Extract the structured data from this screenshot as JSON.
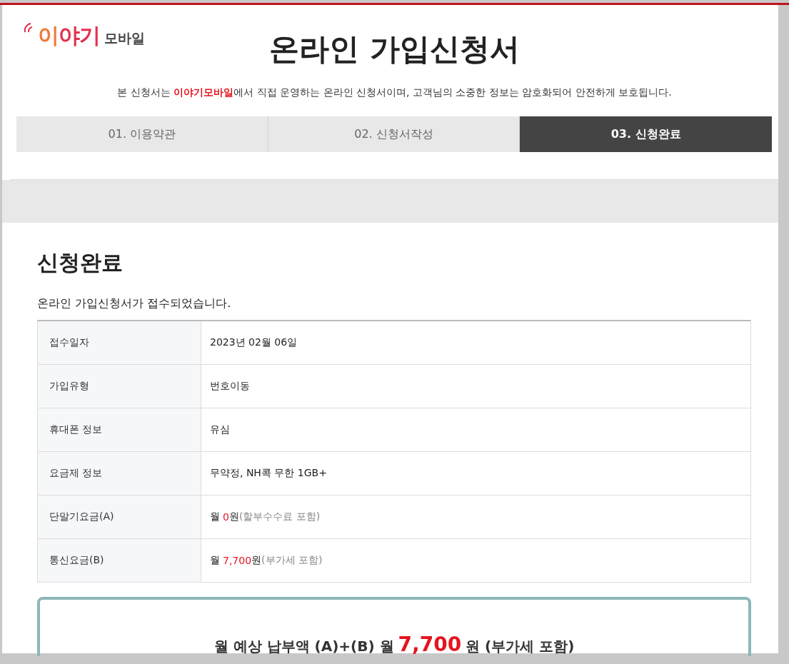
{
  "logo": {
    "brand": "이야기",
    "suffix": "모바일"
  },
  "title": "온라인 가입신청서",
  "intro": "본 신청서는 **이야기모바일**에서 직접 운영하는 온라인 신청서이며, 고객님의 소중한 정보는 암호화되어 안전하게 보호됩니다.",
  "steps": [
    {
      "label": "01. 이용약관",
      "selected": false
    },
    {
      "label": "02. 신청서작성",
      "selected": false
    },
    {
      "label": "03. 신청완료",
      "selected": true
    }
  ],
  "result": {
    "heading": "신청완료",
    "message": "온라인 가입신청서가 접수되었습니다.",
    "rows": [
      {
        "kind": "text",
        "label": "접수일자",
        "value": "2023년 02월 06일"
      },
      {
        "kind": "text",
        "label": "가입유형",
        "value": "번호이동"
      },
      {
        "kind": "text",
        "label": "휴대폰 정보",
        "value": "유심"
      },
      {
        "kind": "text",
        "label": "요금제 정보",
        "value": "무약정, NH콕 무한 1GB+"
      },
      {
        "kind": "fee",
        "label": "단말기요금(A)",
        "prefix": "월",
        "amount": "0",
        "unit": "원",
        "note": "(할부수수료 포함)"
      },
      {
        "kind": "fee",
        "label": "통신요금(B)",
        "prefix": "월",
        "amount": "7,700",
        "unit": "원",
        "note": "(부가세 포함)"
      }
    ],
    "total": {
      "label": "월 예상 납부액 (A)+(B) 월",
      "amount": "7,700",
      "unit": "원 (부가세 포함)"
    }
  }
}
